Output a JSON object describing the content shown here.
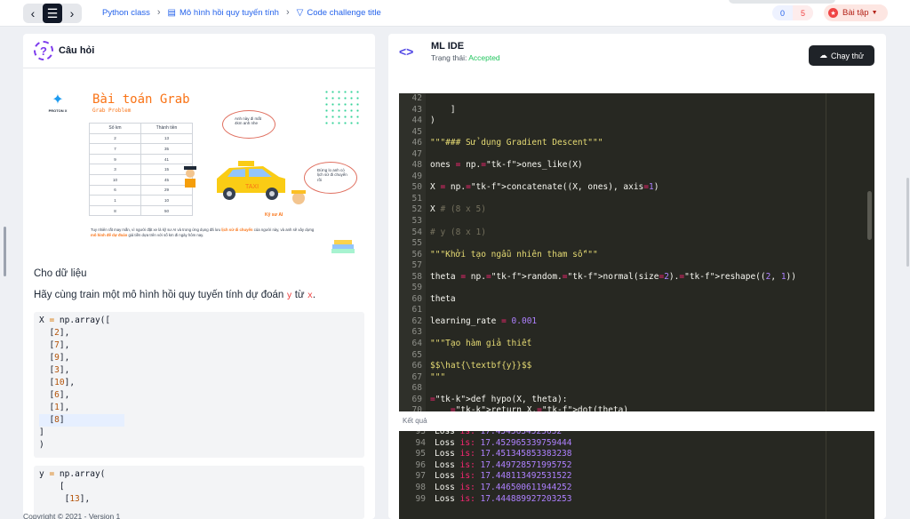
{
  "topbar": {
    "breadcrumbs": [
      "Python class",
      "Mô hình hồi quy tuyến tính",
      "Code challenge title"
    ],
    "count_done": "0",
    "count_total": "5",
    "homework_label": "Bài tập"
  },
  "question": {
    "title": "Câu hỏi",
    "banner": {
      "brand": "PROTON X",
      "title": "Bài toán Grab",
      "subtitle": "Grab Problem",
      "table_headers": [
        "Số km",
        "Thành tiền"
      ],
      "table_rows": [
        [
          "2",
          "13"
        ],
        [
          "7",
          "35"
        ],
        [
          "9",
          "41"
        ],
        [
          "3",
          "15"
        ],
        [
          "10",
          "45"
        ],
        [
          "6",
          "29"
        ],
        [
          "1",
          "10"
        ],
        [
          "8",
          "50"
        ]
      ],
      "bubble1": "Anh này đi mất 4km anh nhe",
      "bubble2": "Đừng lo anh có lịch sử đi chuyển rồi",
      "taxi": "TAXI",
      "engineer_label": "Kỹ sư AI",
      "description_a": "Tuy nhiên rất may mắn, vì người đặt xe là kỹ sư AI và trong ứng dụng đã lưu ",
      "description_hl1": "lịch sử di chuyển",
      "description_b": " của người này, và anh sẽ xây dựng ",
      "description_hl2": "mô hình để dự đoán",
      "description_c": " giá tiền dựa trên với số km đi ngày hôm nay."
    },
    "para1": "Cho dữ liệu",
    "para2_a": "Hãy cùng train một mô hình hồi quy tuyến tính dự đoán ",
    "para2_y": "y",
    "para2_b": " từ ",
    "para2_x": "x",
    "para2_c": ".",
    "x_code": {
      "head_var": "X",
      "head_eq": " = ",
      "head_call": "np.array([",
      "values": [
        "2",
        "7",
        "9",
        "3",
        "10",
        "6",
        "1",
        "8"
      ],
      "close1": "]",
      "close2": ")"
    },
    "y_code": {
      "head_var": "y",
      "head_eq": " = ",
      "head_call": "np.array(",
      "line2": "[",
      "line3_val": "13"
    }
  },
  "footer": {
    "copyright": "Copyright © 2021 - Version 1"
  },
  "ide": {
    "title": "ML IDE",
    "status_label": "Trạng thái: ",
    "status_value": "Accepted",
    "run_label": "Chạy thử",
    "result_label": "Kết quả",
    "editor_lines": [
      {
        "n": "42",
        "t": ""
      },
      {
        "n": "43",
        "t": "    ]"
      },
      {
        "n": "44",
        "t": ")"
      },
      {
        "n": "45",
        "t": ""
      },
      {
        "n": "46",
        "t": "\"\"\"### Sử dụng Gradient Descent\"\"\""
      },
      {
        "n": "47",
        "t": ""
      },
      {
        "n": "48",
        "t": "ones = np.ones_like(X)"
      },
      {
        "n": "49",
        "t": ""
      },
      {
        "n": "50",
        "t": "X = np.concatenate((X, ones), axis=1)"
      },
      {
        "n": "51",
        "t": ""
      },
      {
        "n": "52",
        "t": "X # (8 x 5)"
      },
      {
        "n": "53",
        "t": ""
      },
      {
        "n": "54",
        "t": "# y (8 x 1)"
      },
      {
        "n": "55",
        "t": ""
      },
      {
        "n": "56",
        "t": "\"\"\"Khởi tạo ngẫu nhiên tham số\"\"\""
      },
      {
        "n": "57",
        "t": ""
      },
      {
        "n": "58",
        "t": "theta = np.random.normal(size=2).reshape((2, 1))"
      },
      {
        "n": "59",
        "t": ""
      },
      {
        "n": "60",
        "t": "theta"
      },
      {
        "n": "61",
        "t": ""
      },
      {
        "n": "62",
        "t": "learning_rate = 0.001"
      },
      {
        "n": "63",
        "t": ""
      },
      {
        "n": "64",
        "t": "\"\"\"Tạo hàm giả thiết"
      },
      {
        "n": "65",
        "t": ""
      },
      {
        "n": "66",
        "t": "$$\\hat{\\textbf{y}}$$"
      },
      {
        "n": "67",
        "t": "\"\"\""
      },
      {
        "n": "68",
        "t": ""
      },
      {
        "n": "69",
        "t": "def hypo(X, theta):"
      },
      {
        "n": "70",
        "t": "    return X.dot(theta)"
      }
    ],
    "console_lines": [
      {
        "n": "93",
        "label": "Loss",
        "is": "is:",
        "val": "17.4545634523632"
      },
      {
        "n": "94",
        "label": "Loss",
        "is": "is:",
        "val": "17.452965339759444"
      },
      {
        "n": "95",
        "label": "Loss",
        "is": "is:",
        "val": "17.451345853383238"
      },
      {
        "n": "96",
        "label": "Loss",
        "is": "is:",
        "val": "17.449728571995752"
      },
      {
        "n": "97",
        "label": "Loss",
        "is": "is:",
        "val": "17.448113492531522"
      },
      {
        "n": "98",
        "label": "Loss",
        "is": "is:",
        "val": "17.446500611944252"
      },
      {
        "n": "99",
        "label": "Loss",
        "is": "is:",
        "val": "17.444889927203253"
      }
    ]
  },
  "colors": {
    "accent": "#4f46e5",
    "accepted": "#22c55e",
    "editor_bg": "#272822"
  }
}
